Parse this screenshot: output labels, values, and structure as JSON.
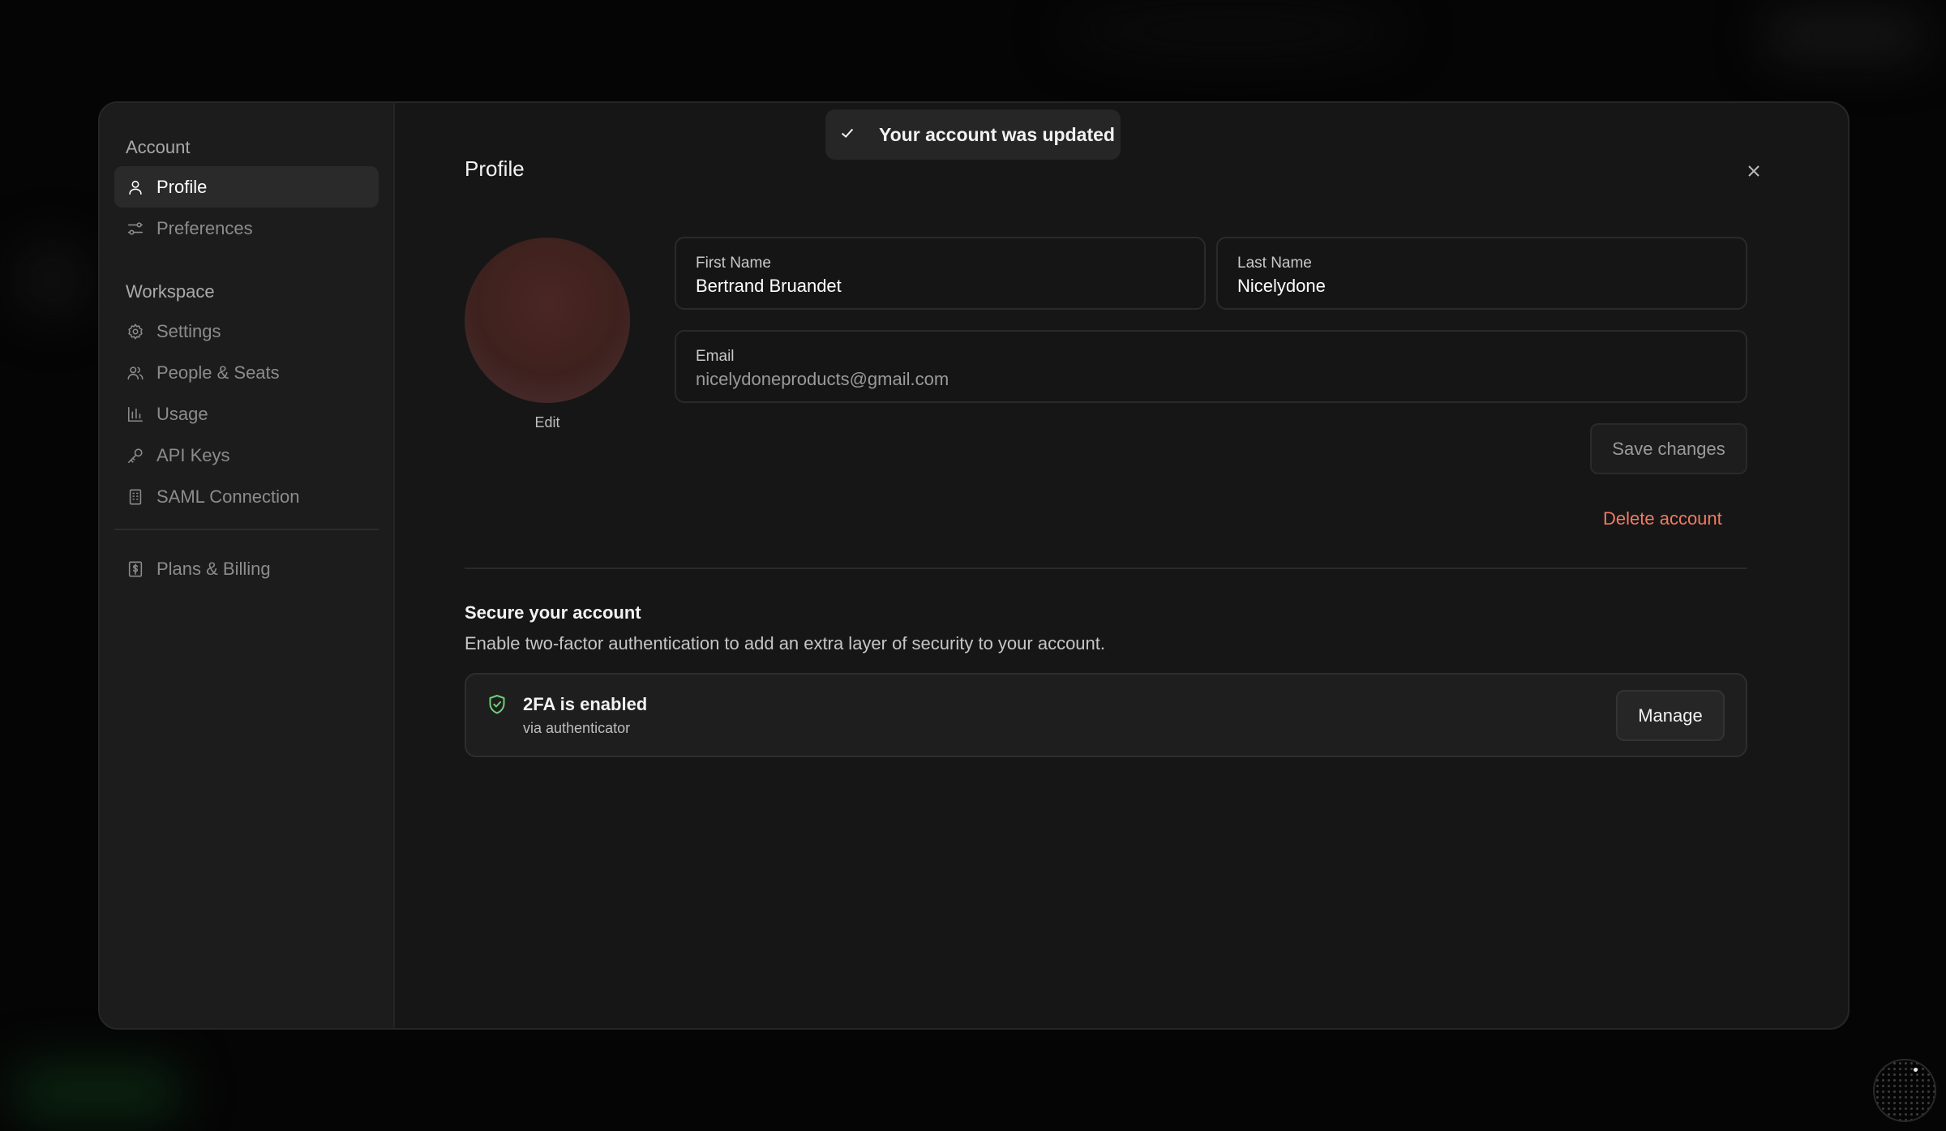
{
  "toast": {
    "message": "Your account was updated"
  },
  "sidebar": {
    "account_title": "Account",
    "account_items": [
      {
        "label": "Profile",
        "icon": "user-icon",
        "active": true
      },
      {
        "label": "Preferences",
        "icon": "sliders-icon",
        "active": false
      }
    ],
    "workspace_title": "Workspace",
    "workspace_items": [
      {
        "label": "Settings",
        "icon": "gear-icon"
      },
      {
        "label": "People & Seats",
        "icon": "users-icon"
      },
      {
        "label": "Usage",
        "icon": "bar-chart-icon"
      },
      {
        "label": "API Keys",
        "icon": "key-icon"
      },
      {
        "label": "SAML Connection",
        "icon": "building-icon"
      }
    ],
    "billing_item": {
      "label": "Plans & Billing",
      "icon": "dollar-receipt-icon"
    }
  },
  "profile": {
    "title": "Profile",
    "avatar_edit_label": "Edit",
    "first_name": {
      "label": "First Name",
      "value": "Bertrand Bruandet"
    },
    "last_name": {
      "label": "Last Name",
      "value": "Nicelydone"
    },
    "email": {
      "label": "Email",
      "value": "nicelydoneproducts@gmail.com"
    },
    "save_label": "Save changes",
    "delete_label": "Delete account"
  },
  "security": {
    "title": "Secure your account",
    "description": "Enable two-factor authentication to add an extra layer of security to your account.",
    "status_title": "2FA is enabled",
    "status_sub": "via authenticator",
    "manage_label": "Manage"
  },
  "colors": {
    "accent_danger": "#f07a64",
    "accent_success": "#6fcf7a",
    "background": "#050505",
    "panel": "#161616"
  }
}
